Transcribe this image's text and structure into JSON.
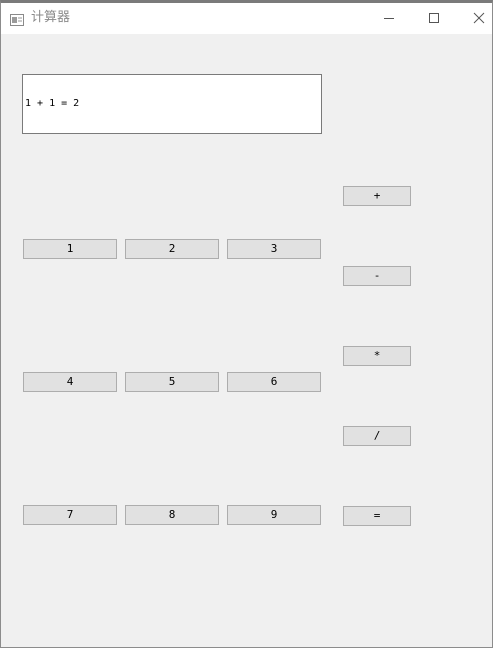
{
  "window": {
    "title": "计算器"
  },
  "display": {
    "text": "1 + 1 = 2"
  },
  "digits": {
    "d1": "1",
    "d2": "2",
    "d3": "3",
    "d4": "4",
    "d5": "5",
    "d6": "6",
    "d7": "7",
    "d8": "8",
    "d9": "9"
  },
  "operators": {
    "plus": "+",
    "minus": "-",
    "multiply": "*",
    "divide": "/",
    "equals": "="
  },
  "icons": {
    "app": "window-app-icon",
    "minimize": "minimize-icon",
    "maximize": "maximize-icon",
    "close": "close-icon"
  }
}
